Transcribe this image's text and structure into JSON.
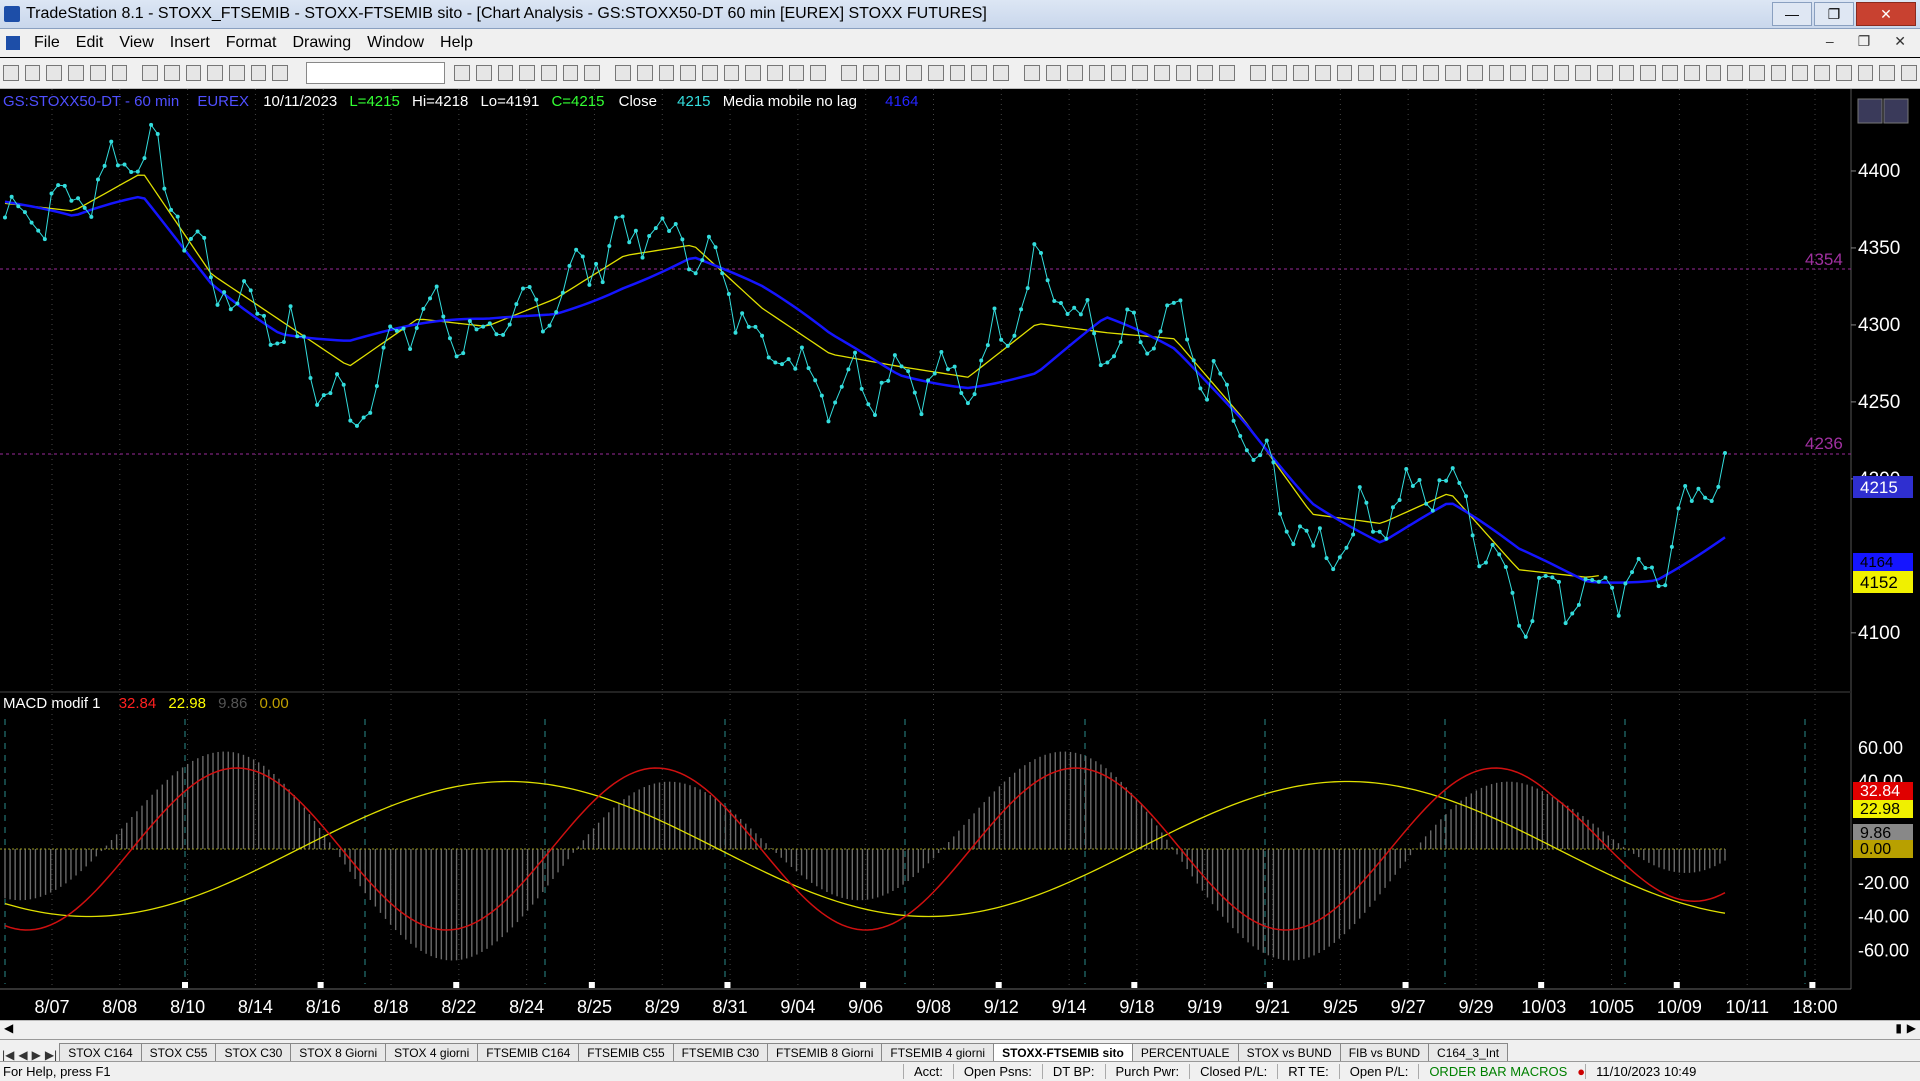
{
  "window": {
    "title": "TradeStation 8.1 - STOXX_FTSEMIB - STOXX-FTSEMIB sito - [Chart Analysis - GS:STOXX50-DT  60 min  [EUREX] STOXX FUTURES]"
  },
  "menu": [
    "File",
    "Edit",
    "View",
    "Insert",
    "Format",
    "Drawing",
    "Window",
    "Help"
  ],
  "chart": {
    "symbol": "GS:STOXX50-DT - 60 min",
    "exchange": "EUREX",
    "date": "10/11/2023",
    "low_readout": "L=4215",
    "high": "Hi=4218",
    "low": "Lo=4191",
    "close": "C=4215",
    "close_label": "Close",
    "close_value": "4215",
    "ma_name": "Media mobile no lag",
    "ma_value": "4164",
    "price_ticks": [
      "4400",
      "4350",
      "4300",
      "4250",
      "4200",
      "4100"
    ],
    "price_tick_values": [
      4400,
      4350,
      4300,
      4250,
      4200,
      4100
    ],
    "level_hi": "4354",
    "level_lo": "4236",
    "badge_close": "4215",
    "badge_ma_blue": "4164",
    "badge_ma_yellow": "4152",
    "macd": {
      "name": "MACD modif 1",
      "v1": "32.84",
      "v2": "22.98",
      "v3": "9.86",
      "v4": "0.00",
      "ticks": [
        "60.00",
        "40.00",
        "-20.00",
        "-40.00",
        "-60.00"
      ],
      "tick_values": [
        60,
        40,
        -20,
        -40,
        -60
      ]
    },
    "date_labels": [
      "8/07",
      "8/08",
      "8/10",
      "8/14",
      "8/16",
      "8/18",
      "8/22",
      "8/24",
      "8/25",
      "8/29",
      "8/31",
      "9/04",
      "9/06",
      "9/08",
      "9/12",
      "9/14",
      "9/18",
      "9/19",
      "9/21",
      "9/25",
      "9/27",
      "9/29",
      "10/03",
      "10/05",
      "10/09",
      "10/11",
      "18:00"
    ],
    "colors": {
      "price_dots": "#33dddd",
      "ma_blue": "#1515ff",
      "ma_yellow": "#e0e000",
      "macd_red": "#d01010",
      "grid_purple": "#b030b0"
    }
  },
  "chart_data": {
    "type": "line",
    "x": [
      "8/07",
      "8/08",
      "8/10",
      "8/14",
      "8/16",
      "8/18",
      "8/22",
      "8/24",
      "8/25",
      "8/29",
      "8/31",
      "9/04",
      "9/06",
      "9/08",
      "9/12",
      "9/14",
      "9/18",
      "9/19",
      "9/21",
      "9/25",
      "9/27",
      "9/29",
      "10/03",
      "10/05",
      "10/09",
      "10/11"
    ],
    "series": [
      {
        "name": "Close",
        "values": [
          4370,
          4380,
          4420,
          4330,
          4300,
          4240,
          4310,
          4290,
          4320,
          4360,
          4355,
          4290,
          4260,
          4270,
          4260,
          4340,
          4280,
          4300,
          4230,
          4150,
          4180,
          4200,
          4120,
          4130,
          4140,
          4215
        ]
      },
      {
        "name": "Media mobile no lag",
        "values": [
          4380,
          4365,
          4380,
          4330,
          4300,
          4290,
          4295,
          4300,
          4310,
          4330,
          4345,
          4320,
          4290,
          4270,
          4265,
          4270,
          4300,
          4280,
          4240,
          4190,
          4160,
          4180,
          4150,
          4135,
          4140,
          4164
        ]
      }
    ],
    "ylim": [
      4070,
      4450
    ]
  },
  "tabs": [
    "STOX C164",
    "STOX C55",
    "STOX  C30",
    "STOX  8 Giorni",
    "STOX 4 giorni",
    "FTSEMIB C164",
    "FTSEMIB C55",
    "FTSEMIB C30",
    "FTSEMIB  8 Giorni",
    "FTSEMIB  4 giorni",
    "STOXX-FTSEMIB sito",
    "PERCENTUALE",
    "STOX vs BUND",
    "FIB vs BUND",
    "C164_3_Int"
  ],
  "status": {
    "help": "For Help, press F1",
    "acct": "Acct:",
    "open_psns": "Open Psns:",
    "dt_bp": "DT BP:",
    "purch_pwr": "Purch Pwr:",
    "closed_pl": "Closed P/L:",
    "rt_te": "RT TE:",
    "open_pl": "Open P/L:",
    "macros": "ORDER BAR  MACROS",
    "datetime": "11/10/2023 10:49"
  }
}
